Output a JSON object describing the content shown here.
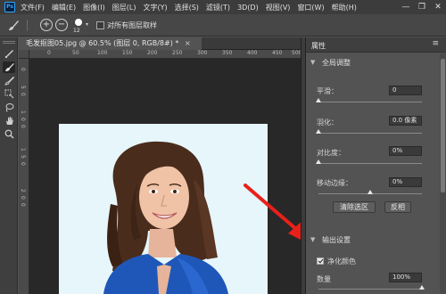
{
  "app": {
    "logo": "Ps",
    "menu": [
      "文件(F)",
      "编辑(E)",
      "图像(I)",
      "图层(L)",
      "文字(Y)",
      "选择(S)",
      "滤镜(T)",
      "3D(D)",
      "视图(V)",
      "窗口(W)",
      "帮助(H)"
    ],
    "window_controls": {
      "minimize": "—",
      "maximize": "❐",
      "close": "✕"
    }
  },
  "options": {
    "brush_size": "12",
    "sample_all_layers_label": "对所有图层取样",
    "sample_all_layers_checked": false
  },
  "tools": [
    {
      "name": "quick-selection-tool-icon",
      "glyph": "✎",
      "active": false
    },
    {
      "name": "refine-edge-brush-icon",
      "glyph": "✎",
      "active": true
    },
    {
      "name": "brush-tool-icon",
      "glyph": "✎",
      "active": false
    },
    {
      "name": "object-selection-icon",
      "glyph": "⬚",
      "active": false
    },
    {
      "name": "lasso-tool-icon",
      "glyph": "◌",
      "active": false
    },
    {
      "name": "hand-tool-icon",
      "glyph": "✋",
      "active": false
    },
    {
      "name": "zoom-tool-icon",
      "glyph": "⌕",
      "active": false
    }
  ],
  "document": {
    "tab_title": "毛发抠图05.jpg @ 60.5% (图层 0, RGB/8#) *",
    "tab_close": "×",
    "ruler_top": [
      "0",
      "50",
      "100",
      "150",
      "200",
      "250",
      "300",
      "350",
      "400",
      "450",
      "500"
    ],
    "ruler_left": [
      "0",
      "5",
      "0",
      "1",
      "0",
      "0",
      "1",
      "5",
      "0",
      "2",
      "0",
      "0"
    ]
  },
  "properties": {
    "title": "属性",
    "panel_menu": "≡",
    "global_section": "全局调整",
    "fields": [
      {
        "label": "平滑：",
        "value": "0",
        "level": 0.0
      },
      {
        "label": "羽化：",
        "value": "0.0 像素",
        "level": 0.0
      },
      {
        "label": "对比度：",
        "value": "0%",
        "level": 0.0
      },
      {
        "label": "移动边缘：",
        "value": "0%",
        "level": 0.5
      }
    ],
    "buttons": {
      "clear_selection": "清除选区",
      "invert": "反相"
    },
    "output_section": "输出设置",
    "decontaminate_label": "净化颜色",
    "decontaminate_checked": true,
    "amount_label": "数量",
    "amount_value": "100%",
    "amount_level": 1.0
  },
  "colors": {
    "menubar_bg": "#3c3c3c",
    "panel_bg": "#535353",
    "canvas_bg": "#282828",
    "image_background": "#e6f6fb",
    "annotation_arrow": "#e8201a"
  }
}
